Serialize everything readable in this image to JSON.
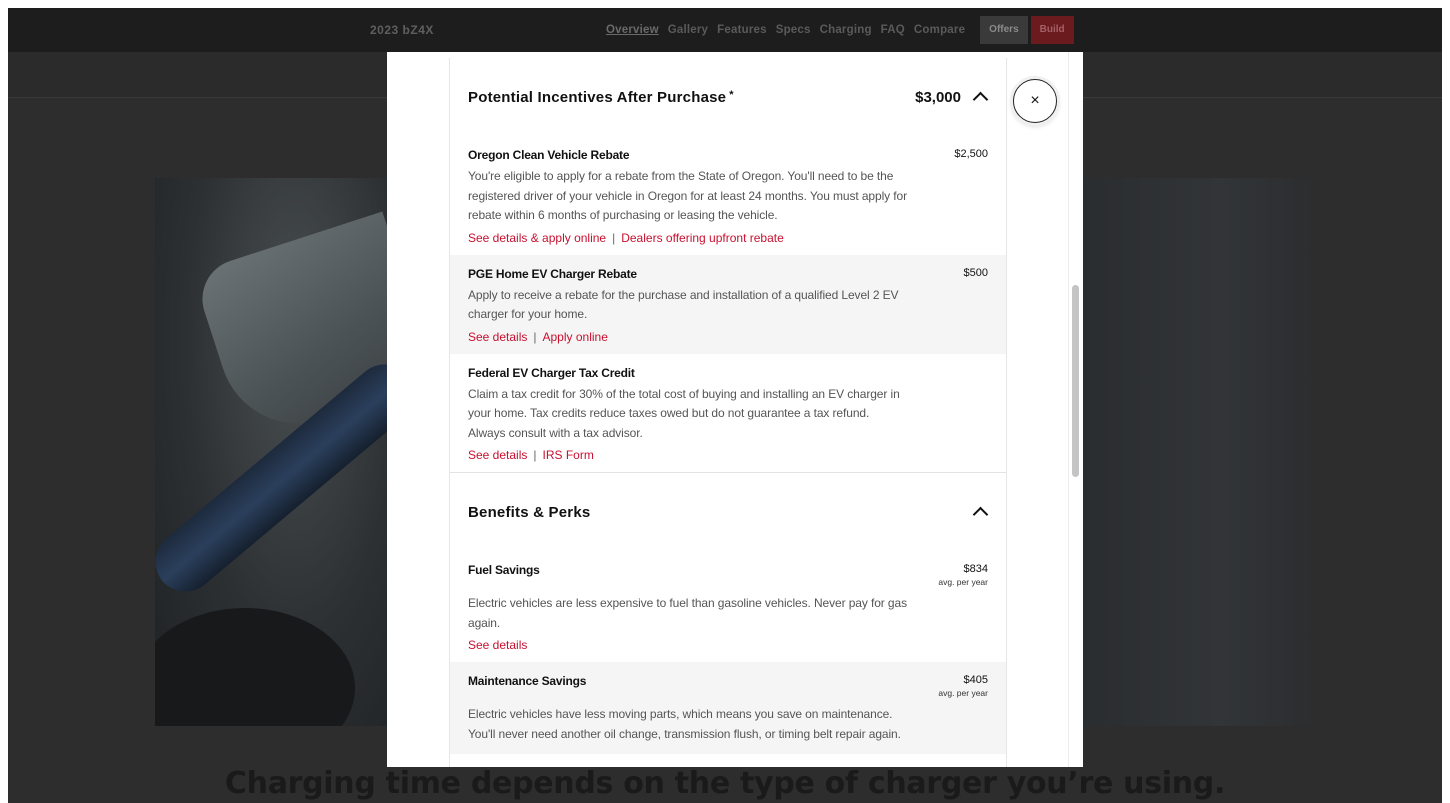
{
  "nav": {
    "model": "2023 bZ4X",
    "links": [
      "Overview",
      "Gallery",
      "Features",
      "Specs",
      "Charging",
      "FAQ",
      "Compare"
    ],
    "offers_label": "Offers",
    "build_label": "Build"
  },
  "page": {
    "bottom_heading": "Charging time depends on the type of charger you’re using."
  },
  "modal": {
    "close_label": "×",
    "incentives": {
      "title": "Potential Incentives After Purchase",
      "asterisk": "*",
      "total": "$3,000",
      "items": [
        {
          "title": "Oregon Clean Vehicle Rebate",
          "amount": "$2,500",
          "description": "You're eligible to apply for a rebate from the State of Oregon. You'll need to be the registered driver of your vehicle in Oregon for at least 24 months. You must apply for rebate within 6 months of purchasing or leasing the vehicle.",
          "links": [
            "See details & apply online",
            "Dealers offering upfront rebate"
          ]
        },
        {
          "title": "PGE Home EV Charger Rebate",
          "amount": "$500",
          "description": "Apply to receive a rebate for the purchase and installation of a qualified Level 2 EV charger for your home.",
          "links": [
            "See details",
            "Apply online"
          ]
        },
        {
          "title": "Federal EV Charger Tax Credit",
          "amount": "",
          "description": "Claim a tax credit for 30% of the total cost of buying and installing an EV charger in your home. Tax credits reduce taxes owed but do not guarantee a tax refund. Always consult with a tax advisor.",
          "links": [
            "See details",
            "IRS Form"
          ]
        }
      ]
    },
    "benefits": {
      "title": "Benefits & Perks",
      "items": [
        {
          "title": "Fuel Savings",
          "amount": "$834",
          "amount_sub": "avg. per year",
          "description": "Electric vehicles are less expensive to fuel than gasoline vehicles. Never pay for gas again.",
          "links": [
            "See details"
          ]
        },
        {
          "title": "Maintenance Savings",
          "amount": "$405",
          "amount_sub": "avg. per year",
          "description": "Electric vehicles have less moving parts, which means you save on maintenance. You'll never need another oil change, transmission flush, or timing belt repair again.",
          "links": []
        }
      ]
    }
  }
}
